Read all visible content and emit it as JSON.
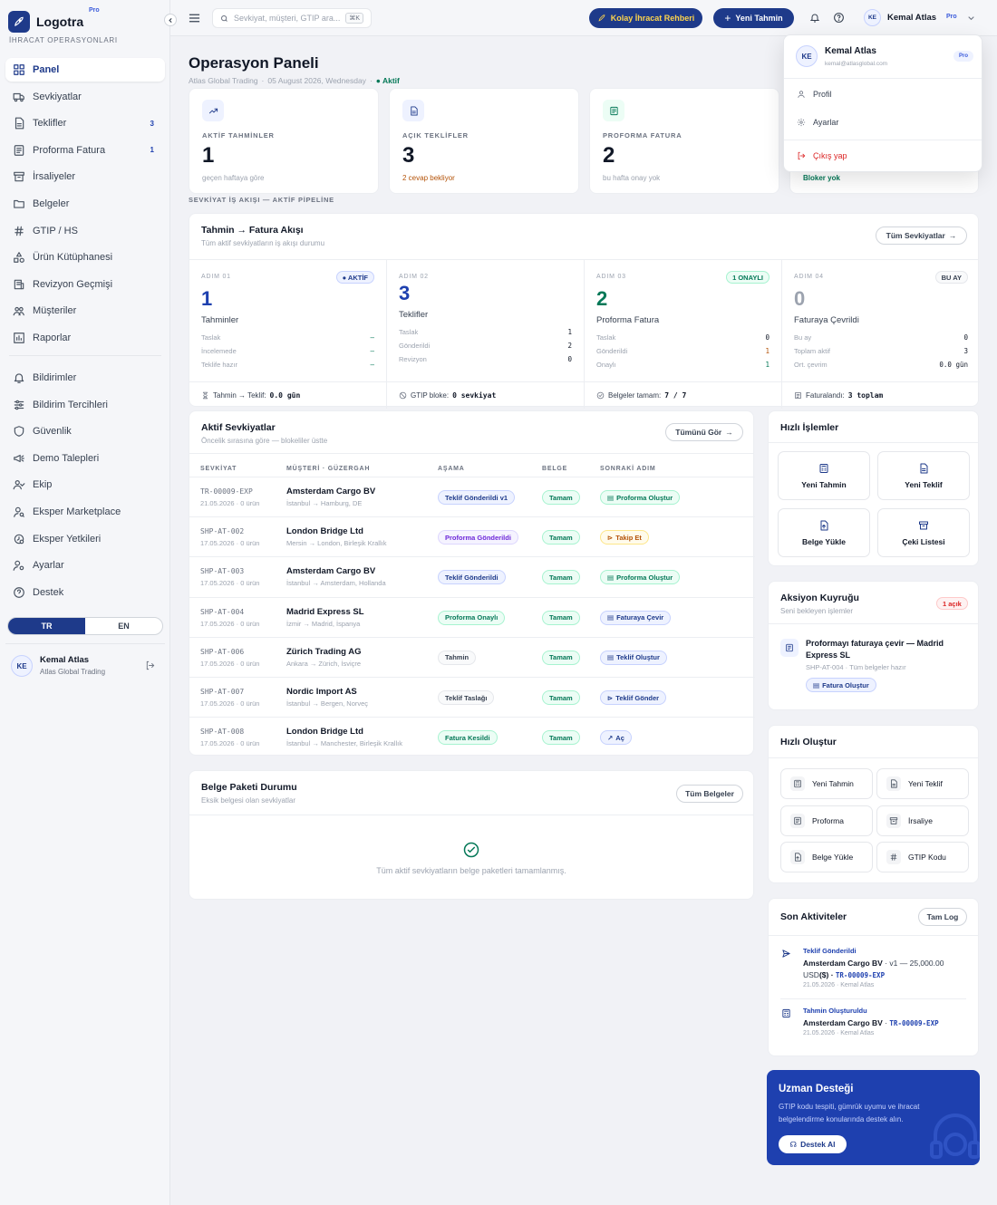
{
  "brand": {
    "name": "Logotra",
    "plan": "Pro",
    "subtitle": "İHRACAT OPERASYONLARI"
  },
  "sidebar": {
    "items": [
      {
        "label": "Panel",
        "icon": "grid-icon",
        "active": true,
        "count": ""
      },
      {
        "label": "Sevkiyatlar",
        "icon": "truck-icon",
        "count": ""
      },
      {
        "label": "Teklifler",
        "icon": "document-icon",
        "count": "3"
      },
      {
        "label": "Proforma Fatura",
        "icon": "invoice-icon",
        "count": "1"
      },
      {
        "label": "İrsaliyeler",
        "icon": "archive-icon",
        "count": ""
      },
      {
        "label": "Belgeler",
        "icon": "folder-icon",
        "count": ""
      },
      {
        "label": "GTIP / HS",
        "icon": "hash-icon",
        "count": ""
      },
      {
        "label": "Ürün Kütüphanesi",
        "icon": "shapes-icon",
        "count": ""
      },
      {
        "label": "Revizyon Geçmişi",
        "icon": "history-icon",
        "count": ""
      }
    ],
    "items2": [
      {
        "label": "Müşteriler",
        "icon": "users-icon"
      },
      {
        "label": "Raporlar",
        "icon": "chart-icon"
      }
    ],
    "items3": [
      {
        "label": "Bildirimler",
        "icon": "bell-icon"
      },
      {
        "label": "Bildirim Tercihleri",
        "icon": "sliders-icon"
      },
      {
        "label": "Güvenlik",
        "icon": "shield-icon"
      },
      {
        "label": "Demo Talepleri",
        "icon": "megaphone-icon"
      },
      {
        "label": "Ekip",
        "icon": "team-icon"
      },
      {
        "label": "Eksper Marketplace",
        "icon": "expert-icon"
      },
      {
        "label": "Eksper Yetkileri",
        "icon": "key-icon"
      },
      {
        "label": "Ayarlar",
        "icon": "user-gear-icon"
      },
      {
        "label": "Destek",
        "icon": "help-icon"
      }
    ],
    "lang": {
      "tr": "TR",
      "en": "EN"
    },
    "user": {
      "initials": "KE",
      "name": "Kemal Atlas",
      "company": "Atlas Global Trading"
    }
  },
  "topbar": {
    "search_placeholder": "Sevkiyat, müşteri, GTIP ara...",
    "shortcut": "⌘K",
    "guide_btn": "Kolay İhracat Rehberi",
    "new_btn": "Yeni Tahmin",
    "user_initials": "KE",
    "user_name": "Kemal Atlas",
    "user_plan": "Pro"
  },
  "page": {
    "title": "Operasyon Paneli",
    "company": "Atlas Global Trading",
    "date": "05 August 2026, Wednesday",
    "status": "Aktif"
  },
  "kpis": [
    {
      "label": "AKTİF TAHMİNLER",
      "value": "1",
      "note": "geçen haftaya göre",
      "icon": "trend-up-icon",
      "tint": "#eef2ff",
      "color": "#1e3a8a",
      "noteColor": "#9ca3af"
    },
    {
      "label": "AÇIK TEKLİFLER",
      "value": "3",
      "note": "2 cevap bekliyor",
      "icon": "document-icon",
      "tint": "#eef2ff",
      "color": "#1e3a8a",
      "noteColor": "#b45309"
    },
    {
      "label": "PROFORMA FATURA",
      "value": "2",
      "note": "bu hafta onay yok",
      "icon": "invoice-icon",
      "tint": "#ecfdf5",
      "color": "#047857",
      "noteColor": "#9ca3af"
    },
    {
      "note": "Bloker yok",
      "noteColor": "#047857"
    }
  ],
  "pipeline_label": "SEVKİYAT İŞ AKIŞI — AKTİF PİPELİNE",
  "pipeline": {
    "title": "Tahmin → Fatura Akışı",
    "subtitle": "Tüm aktif sevkiyatların iş akışı durumu",
    "button": "Tüm Sevkiyatlar",
    "steps": [
      {
        "step": "ADIM 01",
        "count": "1",
        "name": "Tahminler",
        "badge": "● AKTİF",
        "badgeClass": "c-blue",
        "countColor": "#1e40af",
        "rows": [
          {
            "k": "Taslak",
            "v": "–",
            "c": "#047857"
          },
          {
            "k": "İncelemede",
            "v": "–",
            "c": "#047857"
          },
          {
            "k": "Teklife hazır",
            "v": "–",
            "c": "#047857"
          }
        ],
        "foot_label": "Tahmin → Teklif:",
        "foot_value": "0.0 gün",
        "foot_icon": "hourglass-icon"
      },
      {
        "step": "ADIM 02",
        "count": "3",
        "name": "Teklifler",
        "badge": "",
        "badgeClass": "",
        "countColor": "#1e40af",
        "rows": [
          {
            "k": "Taslak",
            "v": "1",
            "c": "#111827"
          },
          {
            "k": "Gönderildi",
            "v": "2",
            "c": "#111827"
          },
          {
            "k": "Revizyon",
            "v": "0",
            "c": "#111827"
          }
        ],
        "foot_label": "GTIP bloke:",
        "foot_value": "0 sevkiyat",
        "foot_icon": "block-icon"
      },
      {
        "step": "ADIM 03",
        "count": "2",
        "name": "Proforma Fatura",
        "badge": "1 ONAYLI",
        "badgeClass": "c-green",
        "countColor": "#047857",
        "rows": [
          {
            "k": "Taslak",
            "v": "0",
            "c": "#111827"
          },
          {
            "k": "Gönderildi",
            "v": "1",
            "c": "#b45309"
          },
          {
            "k": "Onaylı",
            "v": "1",
            "c": "#047857"
          }
        ],
        "foot_label": "Belgeler tamam:",
        "foot_value": "7 / 7",
        "foot_icon": "check-circle-icon"
      },
      {
        "step": "ADIM 04",
        "count": "0",
        "name": "Faturaya Çevrildi",
        "badge": "BU AY",
        "badgeClass": "c-gray",
        "countColor": "#9ca3af",
        "rows": [
          {
            "k": "Bu ay",
            "v": "0",
            "c": "#111827"
          },
          {
            "k": "Toplam aktif",
            "v": "3",
            "c": "#111827"
          },
          {
            "k": "Ort. çevrim",
            "v": "0.0 gün",
            "c": "#111827"
          }
        ],
        "foot_label": "Faturalandı:",
        "foot_value": "3 toplam",
        "foot_icon": "receipt-icon"
      }
    ]
  },
  "shipments": {
    "title": "Aktif Sevkiyatlar",
    "subtitle": "Öncelik sırasına göre — blokeliler üstte",
    "button": "Tümünü Gör",
    "headers": [
      "SEVKİYAT",
      "MÜŞTERİ · GÜZERGAH",
      "AŞAMA",
      "BELGE",
      "SONRAKİ ADIM"
    ],
    "rows": [
      {
        "code": "TR-00009-EXP",
        "date": "21.05.2026 · 0 ürün",
        "customer": "Amsterdam Cargo BV",
        "route": "İstanbul → Hamburg, DE",
        "stage": "Teklif Gönderildi v1",
        "stageClass": "c-blue",
        "doc": "Tamam",
        "next": "Proforma Oluştur",
        "nextClass": "c-green",
        "nextIcon": "▤"
      },
      {
        "code": "SHP-AT-002",
        "date": "17.05.2026 · 0 ürün",
        "customer": "London Bridge Ltd",
        "route": "Mersin → London, Birleşik Krallık",
        "stage": "Proforma Gönderildi",
        "stageClass": "c-purple",
        "doc": "Tamam",
        "next": "Takip Et",
        "nextClass": "c-amber",
        "nextIcon": "⊳"
      },
      {
        "code": "SHP-AT-003",
        "date": "17.05.2026 · 0 ürün",
        "customer": "Amsterdam Cargo BV",
        "route": "İstanbul → Amsterdam, Hollanda",
        "stage": "Teklif Gönderildi",
        "stageClass": "c-blue",
        "doc": "Tamam",
        "next": "Proforma Oluştur",
        "nextClass": "c-green",
        "nextIcon": "▤"
      },
      {
        "code": "SHP-AT-004",
        "date": "17.05.2026 · 0 ürün",
        "customer": "Madrid Express SL",
        "route": "İzmir → Madrid, İspanya",
        "stage": "Proforma Onaylı",
        "stageClass": "c-green",
        "doc": "Tamam",
        "next": "Faturaya Çevir",
        "nextClass": "c-blue",
        "nextIcon": "▤"
      },
      {
        "code": "SHP-AT-006",
        "date": "17.05.2026 · 0 ürün",
        "customer": "Zürich Trading AG",
        "route": "Ankara → Zürich, İsviçre",
        "stage": "Tahmin",
        "stageClass": "c-gray",
        "doc": "Tamam",
        "next": "Teklif Oluştur",
        "nextClass": "c-blue",
        "nextIcon": "▤"
      },
      {
        "code": "SHP-AT-007",
        "date": "17.05.2026 · 0 ürün",
        "customer": "Nordic Import AS",
        "route": "İstanbul → Bergen, Norveç",
        "stage": "Teklif Taslağı",
        "stageClass": "c-gray",
        "doc": "Tamam",
        "next": "Teklif Gönder",
        "nextClass": "c-blue",
        "nextIcon": "⊳"
      },
      {
        "code": "SHP-AT-008",
        "date": "17.05.2026 · 0 ürün",
        "customer": "London Bridge Ltd",
        "route": "İstanbul → Manchester, Birleşik Krallık",
        "stage": "Fatura Kesildi",
        "stageClass": "c-green",
        "doc": "Tamam",
        "next": "Aç",
        "nextClass": "c-blue",
        "nextIcon": "↗"
      }
    ]
  },
  "docs": {
    "title": "Belge Paketi Durumu",
    "subtitle": "Eksik belgesi olan sevkiyatlar",
    "button": "Tüm Belgeler",
    "empty": "Tüm aktif sevkiyatların belge paketleri tamamlanmış."
  },
  "quick_actions": {
    "title": "Hızlı İşlemler",
    "items": [
      {
        "label": "Yeni Tahmin",
        "icon": "calc-icon"
      },
      {
        "label": "Yeni Teklif",
        "icon": "document-icon"
      },
      {
        "label": "Belge Yükle",
        "icon": "upload-icon"
      },
      {
        "label": "Çeki Listesi",
        "icon": "archive-icon"
      }
    ]
  },
  "queue": {
    "title": "Aksiyon Kuyruğu",
    "subtitle": "Seni bekleyen işlemler",
    "badge": "1 açık",
    "item_title": "Proformayı faturaya çevir — Madrid Express SL",
    "item_sub": "SHP-AT-004 · Tüm belgeler hazır",
    "item_btn": "Fatura Oluştur"
  },
  "quick_create": {
    "title": "Hızlı Oluştur",
    "items": [
      {
        "label": "Yeni Tahmin",
        "icon": "calc-icon"
      },
      {
        "label": "Yeni Teklif",
        "icon": "document-icon"
      },
      {
        "label": "Proforma",
        "icon": "invoice-icon"
      },
      {
        "label": "İrsaliye",
        "icon": "archive-icon"
      },
      {
        "label": "Belge Yükle",
        "icon": "upload-icon"
      },
      {
        "label": "GTIP Kodu",
        "icon": "hash-icon"
      }
    ]
  },
  "activity": {
    "title": "Son Aktiviteler",
    "button": "Tam Log",
    "items": [
      {
        "type": "Teklif Gönderildi",
        "line1": "Amsterdam Cargo BV",
        "line1b": " · v1 — 25,000.00 USD",
        "line2": "($) · ",
        "ref": "TR-00009-EXP",
        "meta": "21.05.2026 · Kemal Atlas",
        "icon": "send-icon"
      },
      {
        "type": "Tahmin Oluşturuldu",
        "line1": "Amsterdam Cargo BV",
        "line1b": " · ",
        "line2": "",
        "ref": "TR-00009-EXP",
        "meta": "21.05.2026 · Kemal Atlas",
        "icon": "calc-icon"
      }
    ]
  },
  "support": {
    "title": "Uzman Desteği",
    "text": "GTIP kodu tespiti, gümrük uyumu ve ihracat belgelendirme konularında destek alın.",
    "button": "Destek Al"
  },
  "dropdown": {
    "initials": "KE",
    "name": "Kemal Atlas",
    "email": "kemal@atlasglobal.com",
    "plan": "Pro",
    "profile": "Profil",
    "settings": "Ayarlar",
    "logout": "Çıkış yap"
  },
  "colors": {
    "primary": "#1e3a8a",
    "success": "#047857",
    "warning": "#b45309",
    "danger": "#dc2626"
  }
}
